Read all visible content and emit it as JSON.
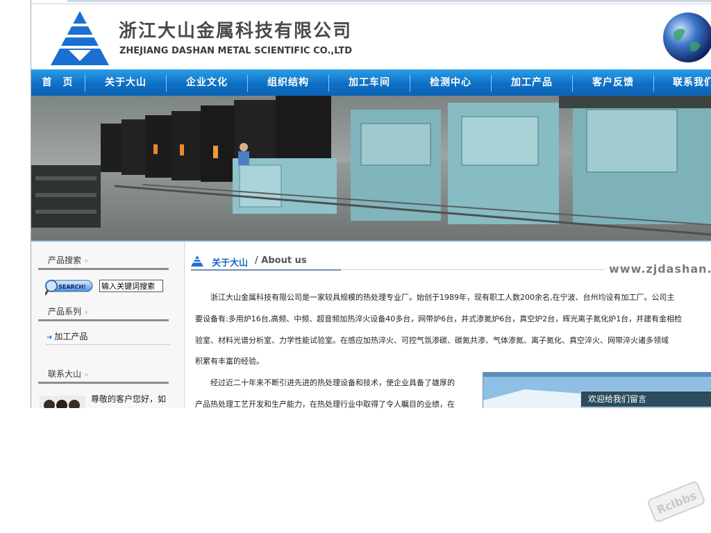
{
  "header": {
    "company_cn": "浙江大山金属科技有限公司",
    "company_en": "ZHEJIANG DASHAN METAL SCIENTIFIC CO.,LTD"
  },
  "nav": {
    "items": [
      "首　页",
      "关于大山",
      "企业文化",
      "组织结构",
      "加工车间",
      "检测中心",
      "加工产品",
      "客户反馈",
      "联系我们"
    ]
  },
  "sidebar": {
    "search_title": "产品搜索",
    "search_button": "SEARCH!",
    "search_value": "输入关键词搜索",
    "series_title": "产品系列",
    "product_link": "加工产品",
    "contact_title": "联系大山",
    "contact_text": "尊敬的客户您好，如"
  },
  "main": {
    "section_cn": "关于大山",
    "section_sep": "/",
    "section_en": "About us",
    "url": "www.zjdashan.cn",
    "paragraphs": [
      "　　浙江大山金属科技有限公司是一家较具规模的热处理专业厂。始创于1989年，现有职工人数200余名,在宁波、台州均设有加工厂。公司主",
      "要设备有:多用炉16台,高频、中频、超音频加热淬火设备40多台，网带炉6台，井式渗氮炉6台，真空炉2台，辉光离子氮化炉1台，并建有金相检",
      "验室、材料光谱分析室、力学性能试验室。在感应加热淬火、可控气氛渗碳、碳氮共渗、气体渗氮、离子氮化、真空淬火、网带淬火诸多领域",
      "积累有丰富的经验。",
      "　　经过近二十年来不断引进先进的热处理设备和技术，使企业具备了雄厚的",
      "产品热处理工艺开发和生产能力，在热处理行业中取得了令人瞩目的业绩，在"
    ],
    "message_bar": "欢迎给我们留言"
  },
  "watermark": "Rclbbs",
  "colors": {
    "nav_blue": "#0f6fc5",
    "heading_blue": "#1769c0",
    "logo_blue": "#1a6fd0"
  }
}
